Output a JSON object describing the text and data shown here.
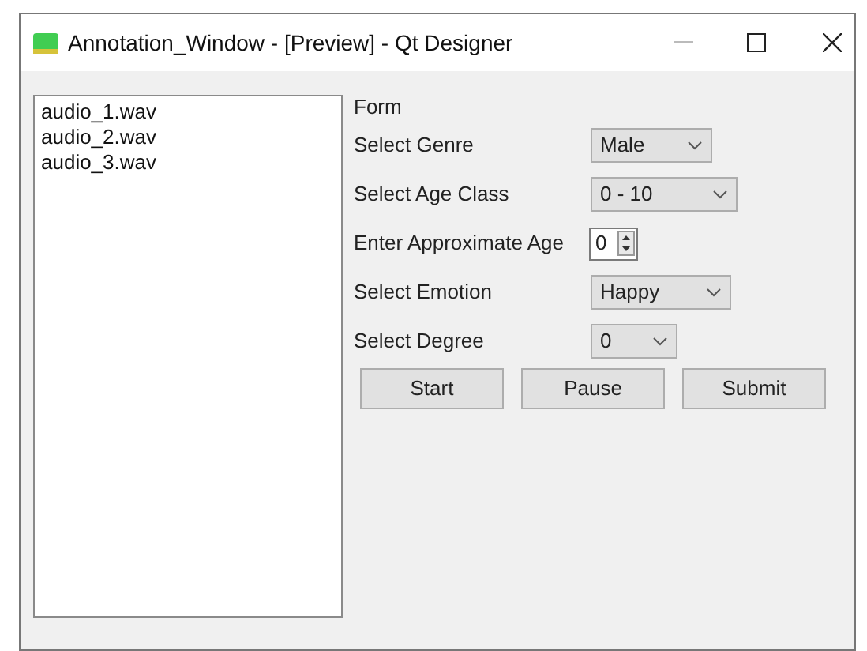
{
  "window": {
    "title": "Annotation_Window - [Preview] - Qt Designer"
  },
  "file_list": {
    "items": [
      {
        "label": "audio_1.wav",
        "selected": false
      },
      {
        "label": "audio_2.wav",
        "selected": false
      },
      {
        "label": "audio_3.wav",
        "selected": false
      }
    ]
  },
  "form": {
    "title": "Form",
    "rows": [
      {
        "label": "Select Genre",
        "kind": "combo",
        "value": "Male"
      },
      {
        "label": "Select Age Class",
        "kind": "combo",
        "value": "0 - 10"
      },
      {
        "label": "Enter Approximate Age",
        "kind": "spin",
        "value": "0"
      },
      {
        "label": "Select Emotion",
        "kind": "combo",
        "value": "Happy"
      },
      {
        "label": "Select Degree",
        "kind": "combo",
        "value": "0"
      }
    ],
    "buttons": [
      "Start",
      "Pause",
      "Submit"
    ]
  }
}
